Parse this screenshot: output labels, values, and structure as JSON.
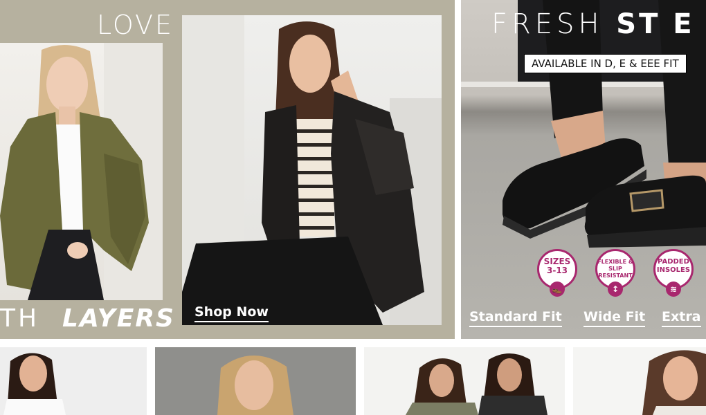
{
  "banner_leather": {
    "headline_top": "LOVE",
    "headline_bottom_prefix": "TH",
    "headline_bottom": "LAYERS",
    "cta_label": "Shop Now"
  },
  "banner_shoes": {
    "headline_light": "FRESH",
    "headline_bold": "ST E P",
    "availability": "AVAILABLE IN D, E & EEE FIT",
    "badges": [
      {
        "lines": "SIZES 3-13",
        "icon": "shoe-icon"
      },
      {
        "lines": "FLEXIBLE & SLIP RESISTANT",
        "icon": "flex-icon"
      },
      {
        "lines": "PADDED INSOLES",
        "icon": "insole-icon"
      }
    ],
    "links": {
      "standard": "Standard Fit",
      "wide": "Wide Fit",
      "extra": "Extra"
    }
  },
  "colors": {
    "banner_bg": "#b6b19f",
    "badge_accent": "#a8276e"
  }
}
